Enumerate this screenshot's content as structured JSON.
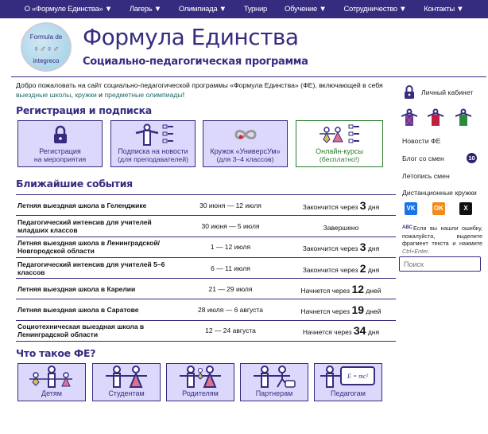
{
  "nav": [
    "О «Формуле Единства» ▼",
    "Лагерь ▼",
    "Олимпиада ▼",
    "Турнир",
    "Обучение ▼",
    "Сотрудничество ▼",
    "Контакты ▼"
  ],
  "logo": {
    "top": "Formula de",
    "bottom": "integreco"
  },
  "header": {
    "title": "Формула Единства",
    "subtitle": "Социально-педагогическая программа"
  },
  "welcome": {
    "text": "Добро пожаловать на сайт социально-педагогической программы «Формула Единства» (ФЕ), включающей в себя ",
    "links": [
      "выездные школы",
      "кружки"
    ],
    "sep": ", ",
    "and": " и ",
    "last": "предметные олимпиады",
    "end": "!"
  },
  "registration": {
    "heading": "Регистрация и подписка",
    "boxes": [
      {
        "title": "Регистрация",
        "sub": "на мероприятия"
      },
      {
        "title": "Подписка на новости",
        "sub": "(для преподавателей)"
      },
      {
        "title": "Кружок «УниверсУм»",
        "sub": "(для 3–4 классов)"
      },
      {
        "title": "Онлайн-курсы",
        "sub": "(бесплатно!)"
      }
    ]
  },
  "events": {
    "heading": "Ближайшие события",
    "rows": [
      {
        "name": "Летняя выездная школа в Геленджике",
        "dates": "30 июня — 12 июля",
        "pre": "Закончится через ",
        "num": "3",
        "post": " дня"
      },
      {
        "name": "Педагогический интенсив для учителей младших классов",
        "dates": "30 июня — 5 июля",
        "pre": "Завершено",
        "num": "",
        "post": ""
      },
      {
        "name": "Летняя выездная школа в Ленинградской/ Новгородской области",
        "dates": "1 — 12 июля",
        "pre": "Закончится через ",
        "num": "3",
        "post": " дня"
      },
      {
        "name": "Педагогический интенсив для учителей 5–6 классов",
        "dates": "6 — 11 июля",
        "pre": "Закончится через ",
        "num": "2",
        "post": " дня"
      },
      {
        "name": "Летняя выездная школа в Карелии",
        "dates": "21 — 29 июля",
        "pre": "Начнется через ",
        "num": "12",
        "post": " дней"
      },
      {
        "name": "Летняя выездная школа в Саратове",
        "dates": "28 июля — 6 августа",
        "pre": "Начнется через ",
        "num": "19",
        "post": " дней"
      },
      {
        "name": "Социотехническая выездная школа в Ленинградской области",
        "dates": "12 — 24 августа",
        "pre": "Начнется через ",
        "num": "34",
        "post": " дня"
      }
    ]
  },
  "what": {
    "heading": "Что такое ФЕ?",
    "boxes": [
      "Детям",
      "Студентам",
      "Родителям",
      "Партнерам",
      "Педагогам"
    ],
    "formula": "E = mc²"
  },
  "sidebar": {
    "cabinet": "Личный кабинет",
    "news": "Новости ФЕ",
    "blog": "Блог со смен",
    "blog_badge": "10",
    "chronicle": "Летопись смен",
    "remote": "Дистанционные кружки",
    "social": [
      "VK",
      "OK",
      "X"
    ],
    "note": "Если вы нашли ошибку, пожалуйста, выделите фрагмент текста и нажмите ",
    "note_keys": "Ctrl+Enter",
    "note_end": ".",
    "search_placeholder": "Поиск",
    "abc": "ABC"
  },
  "colors": {
    "brand": "#352c80",
    "box": "#dcd8fb",
    "green": "#2c7a2c"
  }
}
